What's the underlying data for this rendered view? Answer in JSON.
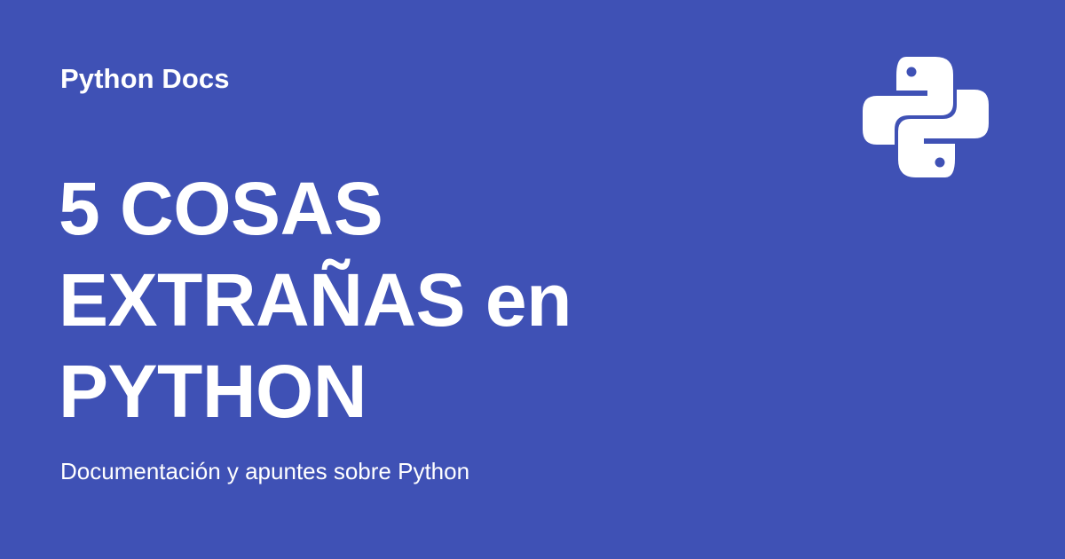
{
  "card": {
    "background_color": "#3f51b5",
    "text_color": "#ffffff",
    "site_name": "Python Docs",
    "title": "5 COSAS EXTRAÑAS en PYTHON",
    "subtitle": "Documentación y apuntes sobre Python",
    "logo_icon": "python-logo-icon"
  }
}
